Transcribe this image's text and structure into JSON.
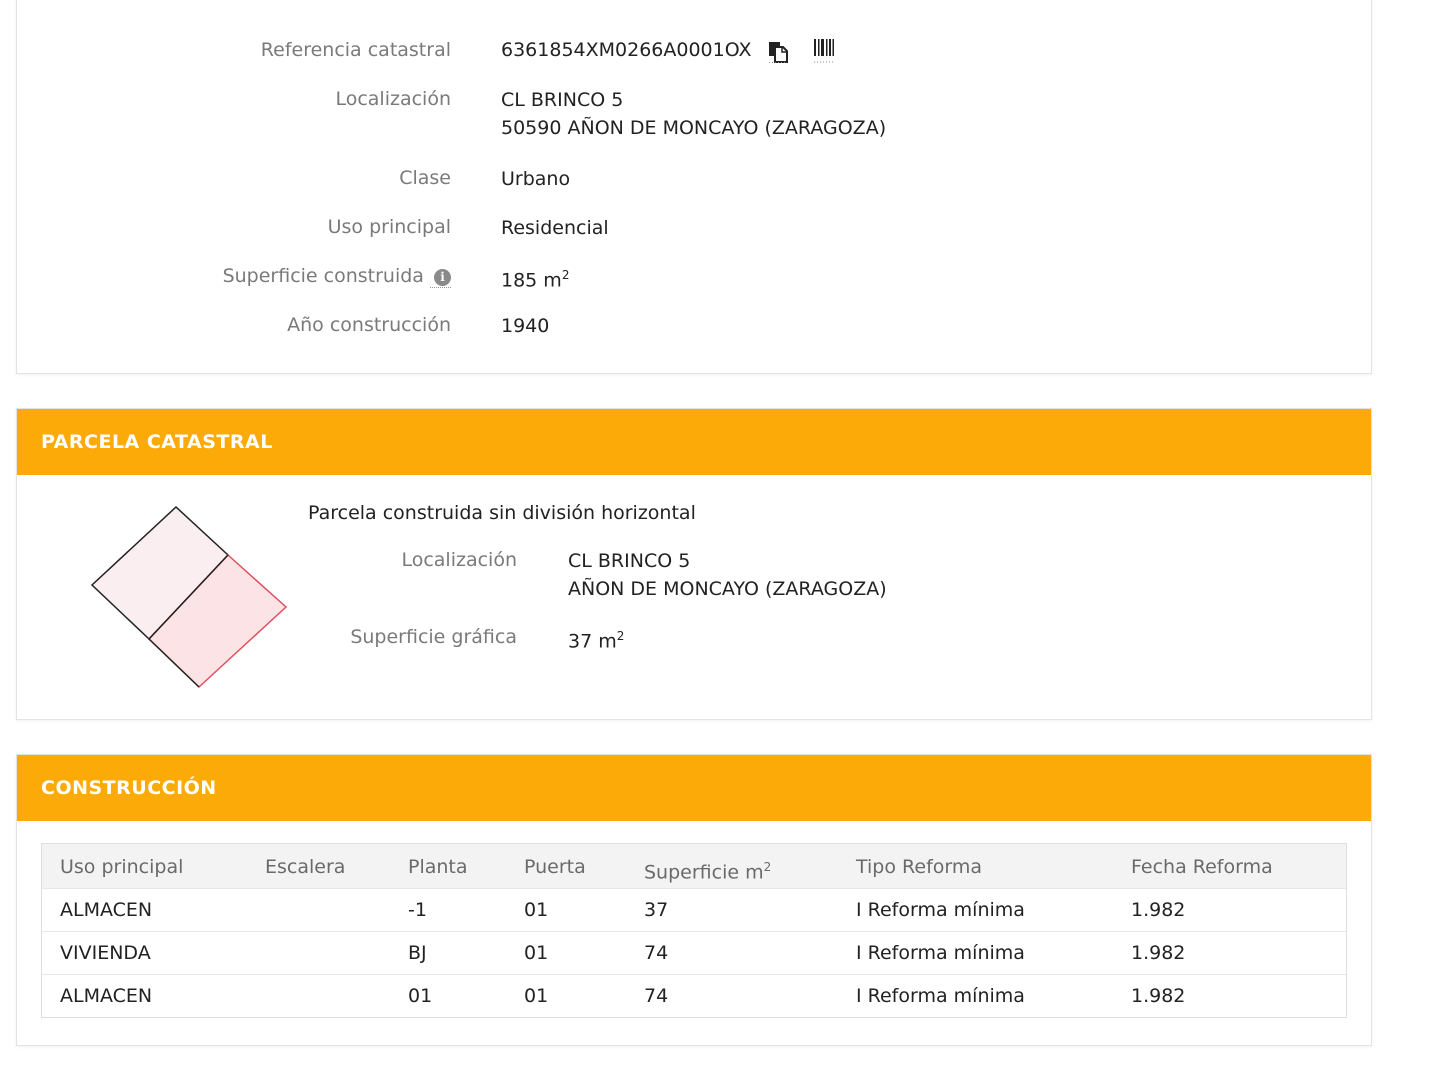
{
  "inmueble": {
    "referencia_label": "Referencia catastral",
    "referencia_value": "6361854XM0266A0001OX",
    "localizacion_label": "Localización",
    "localizacion_line1": "CL BRINCO 5",
    "localizacion_line2": "50590 AÑON DE MONCAYO (ZARAGOZA)",
    "clase_label": "Clase",
    "clase_value": "Urbano",
    "uso_label": "Uso principal",
    "uso_value": "Residencial",
    "superficie_label": "Superficie construida",
    "superficie_value": "185 m",
    "superficie_unit_sup": "2",
    "anio_label": "Año construcción",
    "anio_value": "1940",
    "icons": [
      "copy-icon",
      "barcode-icon",
      "info-icon"
    ]
  },
  "parcela": {
    "header": "PARCELA CATASTRAL",
    "subtitle": "Parcela construida sin división horizontal",
    "localizacion_label": "Localización",
    "localizacion_line1": "CL BRINCO 5",
    "localizacion_line2": "AÑON DE MONCAYO (ZARAGOZA)",
    "superficie_label": "Superficie gráfica",
    "superficie_value": "37 m",
    "superficie_unit_sup": "2",
    "colors": {
      "fill": "#fbeef0",
      "highlight_stroke": "#e0515f",
      "stroke": "#222222"
    }
  },
  "construccion": {
    "header": "CONSTRUCCIÓN",
    "columns": [
      "Uso principal",
      "Escalera",
      "Planta",
      "Puerta",
      "Superficie m",
      "Tipo Reforma",
      "Fecha Reforma"
    ],
    "superficie_sup": "2",
    "rows": [
      [
        "ALMACEN",
        "",
        "-1",
        "01",
        "37",
        "I Reforma mínima",
        "1.982"
      ],
      [
        "VIVIENDA",
        "",
        "BJ",
        "01",
        "74",
        "I Reforma mínima",
        "1.982"
      ],
      [
        "ALMACEN",
        "",
        "01",
        "01",
        "74",
        "I Reforma mínima",
        "1.982"
      ]
    ]
  },
  "colors": {
    "accent": "#fbaa08",
    "label": "#7a7a7a",
    "text": "#222222"
  }
}
